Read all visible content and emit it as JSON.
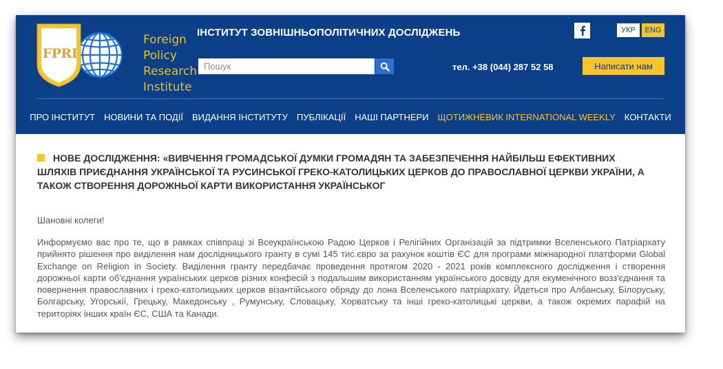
{
  "header": {
    "logo_text_lines": [
      "Foreign",
      "Policy",
      "Research",
      "Institute"
    ],
    "logo_abbr": "FPRI",
    "site_title": "ІНСТИТУТ ЗОВНІШНЬОПОЛІТИЧНИХ ДОСЛІДЖЕНЬ",
    "search_placeholder": "Пошук",
    "phone": "тел. +38 (044) 287 52 58",
    "languages": [
      "УКР",
      "ENG"
    ],
    "write_button": "Написати нам"
  },
  "nav": {
    "items": [
      "ПРО ІНСТИТУТ",
      "НОВИНИ ТА ПОДІЇ",
      "ВИДАННЯ ІНСТИТУТУ",
      "ПУБЛІКАЦІЇ",
      "НАШІ ПАРТНЕРИ",
      "ЩОТИЖНЕВИК INTERNATIONAL WEEKLY",
      "КОНТАКТИ"
    ]
  },
  "article": {
    "title": "НОВЕ ДОСЛІДЖЕННЯ: «ВИВЧЕННЯ ГРОМАДСЬКОЇ ДУМКИ ГРОМАДЯН ТА ЗАБЕЗПЕЧЕННЯ НАЙБІЛЬШ ЕФЕКТИВНИХ ШЛЯХІВ ПРИЄДНАННЯ УКРАЇНСЬКОЇ ТА РУСИНСЬКОЇ ГРЕКО-КАТОЛИЦЬКИХ ЦЕРКОВ ДО ПРАВОСЛАВНОЇ ЦЕРКВИ УКРАЇНИ, А ТАКОЖ СТВОРЕННЯ ДОРОЖНЬОЇ КАРТИ ВИКОРИСТАННЯ УКРАЇНСЬКОГ",
    "greeting": "Шановні колеги!",
    "body": "Информуємо вас про те, що в рамках співпраці зі Всеукраїнською Радою Церков і Релігійних Організацій за підтримки Вселенського Патріархату прийнято рішення про виділення нам дослідницького гранту в сумі 145 тис.євро за рахунок коштів ЄС для програми міжнародної платформи Global Exchange on Religion in Society. Виділення гранту передбачає проведення протягом 2020 - 2021 років комплексного дослідження і створення дорожньої карти об'єднання українських церков різних конфесій з подальшим використанням українського досвіду для екуменічного возз'єднання та повернення православних і греко-католицьких церков візантійського обряду до лона Вселенського патріархату. Йдеться про Албанську, Білоруську, Болгарську, Угорськії, Грецьку, Македонську , Румунську, Словацьку, Хорватську та інші греко-католицькі церкви, а також окремих парафій на територіях інших країн ЄС, США та Канади."
  },
  "colors": {
    "header_bg": "#0b3f88",
    "accent_yellow": "#f4c530",
    "search_button": "#2e6fd1"
  },
  "icons": {
    "search": "search-icon",
    "facebook": "facebook-icon"
  }
}
